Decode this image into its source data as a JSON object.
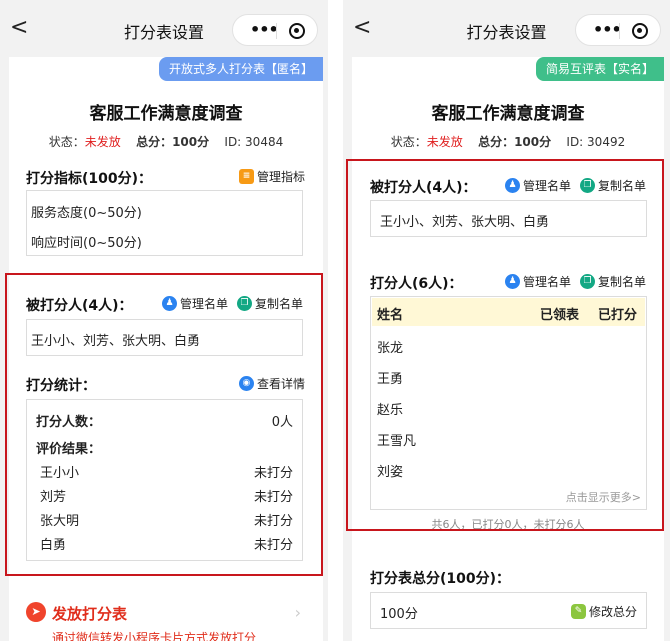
{
  "left": {
    "nav_title": "打分表设置",
    "back_glyph": "<",
    "menu_glyph": "•••",
    "ribbon": "开放式多人打分表【匿名】",
    "survey_title": "客服工作满意度调查",
    "status_label": "状态：",
    "status_value": "未发放",
    "total_label": "总分：",
    "total_value": "100分",
    "id_label": "ID: 30484",
    "criteria_title": "打分指标(100分)：",
    "manage_criteria": "管理指标",
    "criteria": [
      "服务态度(0~50分)",
      "响应时间(0~50分)"
    ],
    "scored_title": "被打分人(4人)：",
    "manage_list": "管理名单",
    "copy_list": "复制名单",
    "scored_names": "王小小、刘芳、张大明、白勇",
    "stats_title": "打分统计：",
    "view_detail": "查看详情",
    "raters_label": "打分人数：",
    "raters_value": "0人",
    "result_label": "评价结果：",
    "results": [
      {
        "name": "王小小",
        "status": "未打分"
      },
      {
        "name": "刘芳",
        "status": "未打分"
      },
      {
        "name": "张大明",
        "status": "未打分"
      },
      {
        "name": "白勇",
        "status": "未打分"
      }
    ],
    "send_title": "发放打分表",
    "send_sub": "通过微信转发小程序卡片方式发放打分",
    "accent_ribbon": "#6b9cf0"
  },
  "right": {
    "nav_title": "打分表设置",
    "back_glyph": "<",
    "menu_glyph": "•••",
    "ribbon": "简易互评表【实名】",
    "survey_title": "客服工作满意度调查",
    "status_label": "状态：",
    "status_value": "未发放",
    "total_label": "总分：",
    "total_value": "100分",
    "id_label": "ID: 30492",
    "scored_title": "被打分人(4人)：",
    "manage_list": "管理名单",
    "copy_list": "复制名单",
    "scored_names": "王小小、刘芳、张大明、白勇",
    "raters_title": "打分人(6人)：",
    "table_headers": {
      "name": "姓名",
      "received": "已领表",
      "scored": "已打分"
    },
    "raters": [
      "张龙",
      "王勇",
      "赵乐",
      "王雪凡",
      "刘姿"
    ],
    "show_more": "点击显示更多>",
    "summary": "共6人，已打分0人，未打分6人",
    "total_title": "打分表总分(100分)：",
    "total_box_value": "100分",
    "modify_total": "修改总分",
    "accent_ribbon": "#3fbf8a"
  },
  "colors": {
    "highlight_frame": "#c8161d",
    "status_red": "#e02020",
    "blue_icon": "#2b83f0",
    "teal_icon": "#13a884"
  },
  "icons": {
    "back": "chevron-left-icon",
    "menu": "more-dots-icon",
    "close": "target-icon",
    "manage_list": "people-icon",
    "copy_list": "copy-icon",
    "manage_criteria": "list-icon",
    "view_detail": "eye-icon",
    "send": "send-icon",
    "modify_total": "edit-icon"
  }
}
